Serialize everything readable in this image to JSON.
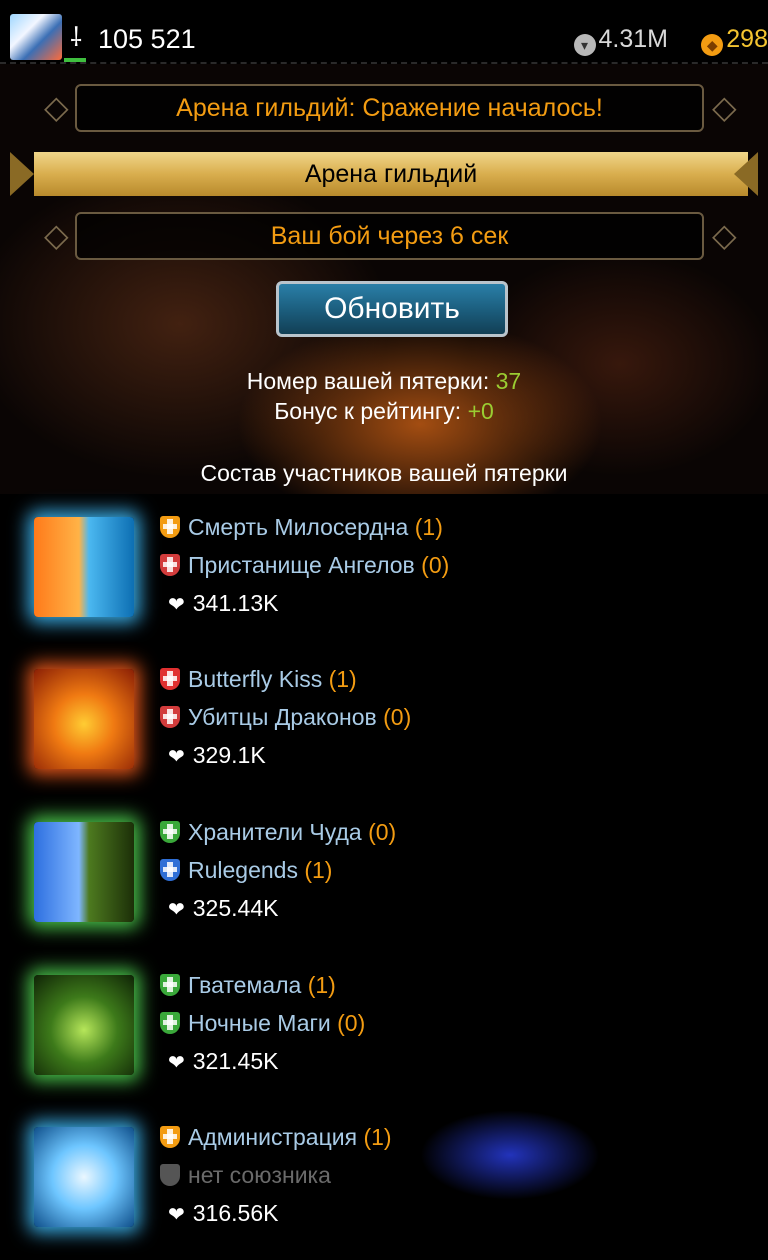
{
  "topbar": {
    "power": "105 521",
    "silver": "4.31M",
    "gold": "298"
  },
  "event_title": "Арена гильдий: Сражение началось!",
  "section_banner": "Арена гильдий",
  "battle_timer": "Ваш бой через 6 сек",
  "refresh_label": "Обновить",
  "team_info": {
    "number_label": "Номер вашей пятерки: ",
    "number_value": "37",
    "bonus_label": "Бонус к рейтингу: ",
    "bonus_value": "+0"
  },
  "participants_title": "Состав участников вашей пятерки",
  "participants": [
    {
      "guild": "Смерть Милосердна",
      "guild_count": "(1)",
      "ally": "Пристанище Ангелов",
      "ally_count": "(0)",
      "power": "341.13K",
      "shield_color": "#f39c12",
      "ally_shield_color": "#d23c3c",
      "glow": "#39a9e0"
    },
    {
      "guild": "Butterfly Kiss",
      "guild_count": "(1)",
      "ally": "Убитцы Драконов",
      "ally_count": "(0)",
      "power": "329.1K",
      "shield_color": "#e03030",
      "ally_shield_color": "#d23c3c",
      "glow": "#e0551a"
    },
    {
      "guild": "Хранители Чуда",
      "guild_count": "(0)",
      "ally": "Rulegends",
      "ally_count": "(1)",
      "power": "325.44K",
      "shield_color": "#3aa83a",
      "ally_shield_color": "#2f6fd6",
      "glow": "#49c24a"
    },
    {
      "guild": "Гватемала",
      "guild_count": "(1)",
      "ally": "Ночные Маги",
      "ally_count": "(0)",
      "power": "321.45K",
      "shield_color": "#3aa83a",
      "ally_shield_color": "#3aa83a",
      "glow": "#49c24a"
    },
    {
      "guild": "Администрация",
      "guild_count": "(1)",
      "ally": "нет союзника",
      "ally_count": "",
      "power": "316.56K",
      "shield_color": "#f39c12",
      "ally_shield_color": "#555555",
      "glow": "#39a9e0"
    }
  ]
}
